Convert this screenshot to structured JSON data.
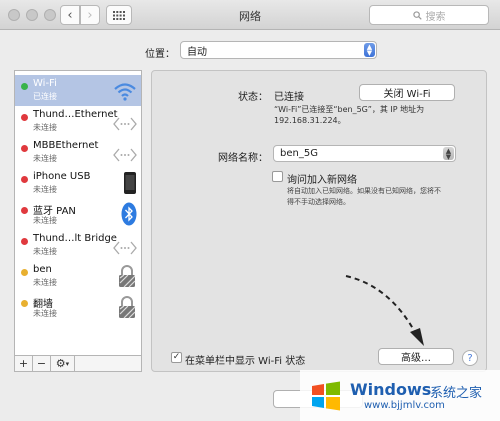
{
  "window": {
    "title": "网络",
    "search_placeholder": "搜索"
  },
  "location": {
    "label": "位置：",
    "value": "自动"
  },
  "services": [
    {
      "name": "Wi-Fi",
      "status": "已连接",
      "dot": "#37b34a",
      "icon": "wifi-icon",
      "selected": true
    },
    {
      "name": "Thund…Ethernet",
      "status": "未连接",
      "dot": "#e0393e",
      "icon": "ethernet-icon",
      "selected": false
    },
    {
      "name": "MBBEthernet",
      "status": "未连接",
      "dot": "#e0393e",
      "icon": "ethernet-icon",
      "selected": false
    },
    {
      "name": "iPhone USB",
      "status": "未连接",
      "dot": "#e0393e",
      "icon": "iphone-icon",
      "selected": false
    },
    {
      "name": "蓝牙 PAN",
      "status": "未连接",
      "dot": "#e0393e",
      "icon": "bluetooth-icon",
      "selected": false
    },
    {
      "name": "Thund…lt Bridge",
      "status": "未连接",
      "dot": "#e0393e",
      "icon": "ethernet-icon",
      "selected": false
    },
    {
      "name": "ben",
      "status": "未连接",
      "dot": "#e8b030",
      "icon": "lock-icon",
      "selected": false
    },
    {
      "name": "翻墙",
      "status": "未连接",
      "dot": "#e8b030",
      "icon": "lock-icon",
      "selected": false
    }
  ],
  "toolbar": {
    "add": "+",
    "remove": "−",
    "gear": "⚙"
  },
  "detail": {
    "status_label": "状态：",
    "status_value": "已连接",
    "turn_off_button": "关闭 Wi-Fi",
    "status_desc_1": "“Wi-Fi”已连接至“ben_5G”，其 IP 地址为",
    "status_desc_2": "192.168.31.224。",
    "network_name_label": "网络名称：",
    "network_name_value": "ben_5G",
    "ask_join_label": "询问加入新网络",
    "ask_join_desc_1": "将自动加入已知网络。如果没有已知网络，您将不",
    "ask_join_desc_2": "得不手动选择网络。",
    "show_menubar_label": "在菜单栏中显示 Wi-Fi 状态",
    "advanced_button": "高级…",
    "help": "?"
  },
  "watermark": {
    "brand": "Windows",
    "cn": "系统之家",
    "url": "www.bjjmlv.com"
  },
  "colors": {
    "selected_row": "#b4c5e4",
    "accent": "#3d73d8",
    "wifi": "#4a8ae0"
  }
}
